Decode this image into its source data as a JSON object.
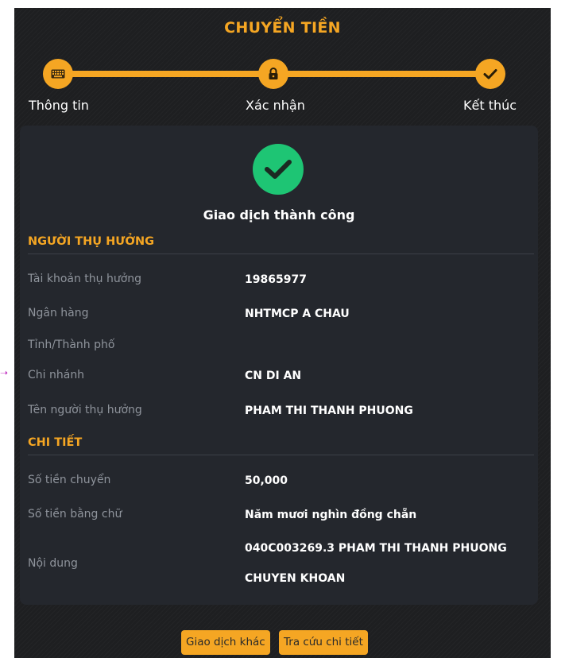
{
  "header": {
    "title": "CHUYỂN TIỀN"
  },
  "stepper": {
    "steps": [
      {
        "label": "Thông tin",
        "icon": "keyboard-icon"
      },
      {
        "label": "Xác nhận",
        "icon": "lock-icon"
      },
      {
        "label": "Kết thúc",
        "icon": "check-icon"
      }
    ],
    "color": "#f5a623"
  },
  "result": {
    "message": "Giao dịch thành công",
    "icon": "success-check-icon",
    "color": "#1ec574"
  },
  "beneficiary": {
    "section_title": "NGƯỜI THỤ HƯỞNG",
    "rows": [
      {
        "label": "Tài khoản thụ hưởng",
        "value": "19865977"
      },
      {
        "label": "Ngân hàng",
        "value": "NHTMCP A CHAU"
      },
      {
        "label": "Tỉnh/Thành phố",
        "value": ""
      },
      {
        "label": "Chi nhánh",
        "value": "CN DI AN"
      },
      {
        "label": "Tên người thụ hưởng",
        "value": "PHAM THI THANH PHUONG"
      }
    ]
  },
  "details": {
    "section_title": "CHI TIẾT",
    "rows": [
      {
        "label": "Số tiền chuyển",
        "value": "50,000"
      },
      {
        "label": "Số tiền bằng chữ",
        "value": "Năm mươi nghìn đồng chẵn"
      }
    ],
    "content": {
      "label": "Nội dung",
      "line1": "040C003269.3 PHAM THI THANH PHUONG",
      "line2": "CHUYEN KHOAN"
    }
  },
  "actions": {
    "other_transaction": "Giao dịch khác",
    "view_details": "Tra cứu chi tiết"
  },
  "theme": {
    "accent": "#f5a623",
    "background": "#1e1f21",
    "card": "#24272d"
  }
}
